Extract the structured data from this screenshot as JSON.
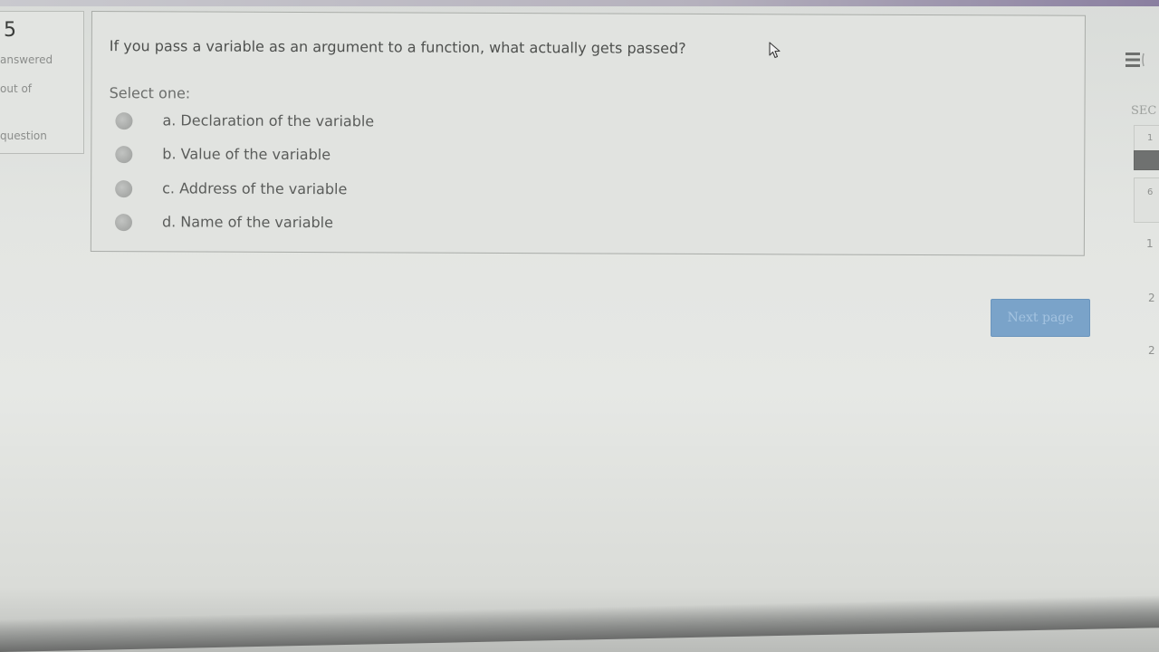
{
  "sidebar_info": {
    "number": "5",
    "line1": "answered",
    "line2": "out of",
    "line3": "question"
  },
  "question": {
    "text": "If you pass a variable as an argument to a function, what actually gets passed?",
    "select_label": "Select one:",
    "options": [
      {
        "label": "a. Declaration of the variable"
      },
      {
        "label": "b. Value of the variable"
      },
      {
        "label": "c. Address of the variable"
      },
      {
        "label": "d. Name of the variable"
      }
    ]
  },
  "actions": {
    "next_label": "Next page"
  },
  "quiz_nav": {
    "menu_icon": "hamburger-icon",
    "label": "SEC",
    "tiles": [
      "1",
      "",
      "6"
    ],
    "numbers": [
      "1",
      "2",
      "2"
    ]
  },
  "colors": {
    "button_bg": "#7aa3c9",
    "panel_border": "#a9aca8",
    "current_tile": "#6f7170"
  }
}
